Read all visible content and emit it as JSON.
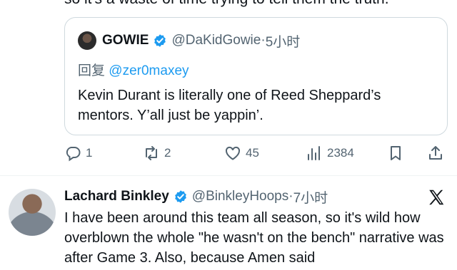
{
  "previous_tweet": {
    "text_tail": "so it's a waste of time trying to tell them the truth."
  },
  "quoted_tweet": {
    "display_name": "GOWIE",
    "handle": "@DaKidGowie",
    "separator": "·",
    "time": "5小时",
    "reply_label": "回复",
    "reply_to": "@zer0maxey",
    "text": "Kevin Durant is literally one of Reed Sheppard’s mentors. Y’all just be yappin’."
  },
  "actions": {
    "replies": "1",
    "reposts": "2",
    "likes": "45",
    "views": "2384"
  },
  "tweet": {
    "display_name": "Lachard Binkley",
    "handle": "@BinkleyHoops",
    "separator": "·",
    "time": "7小时",
    "text": "I have been around this team all season, so it's wild how overblown the whole \"he wasn't on the bench\" narrative was after Game 3.  Also, because Amen said"
  },
  "colors": {
    "accent": "#1d9bf0",
    "secondary_text": "#536471",
    "border": "#cfd9de"
  },
  "icons": [
    "reply-icon",
    "repost-icon",
    "like-icon",
    "views-icon",
    "bookmark-icon",
    "share-icon",
    "verified-badge-icon",
    "x-logo-icon"
  ]
}
